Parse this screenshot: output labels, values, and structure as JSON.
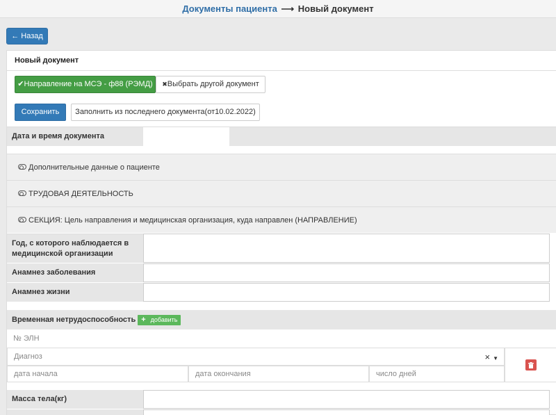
{
  "breadcrumb": {
    "parent": "Документы пациента",
    "arrow": "⟶",
    "current": "Новый документ"
  },
  "back_button": {
    "icon": "←",
    "label": "Назад"
  },
  "panel": {
    "title": "Новый документ"
  },
  "doc_type": {
    "selected_icon": "✔",
    "selected_label": "Направление на МСЭ - ф88 (РЭМД)",
    "other_icon": "✖",
    "other_label": "Выбрать другой документ"
  },
  "actions": {
    "save_label": "Сохранить",
    "fill_label": "Заполнить из последнего документа(от10.02.2022)"
  },
  "fields": {
    "date_label": "Дата и время документа",
    "year_label": "Год, с которого наблюдается в медицинской организации",
    "anamnesis_disease_label": "Анамнез заболевания",
    "anamnesis_life_label": "Анамнез жизни",
    "weight_label": "Масса тела(кг)"
  },
  "sections": [
    {
      "label": "Дополнительные данные о пациенте"
    },
    {
      "label": "ТРУДОВАЯ ДЕЯТЕЛЬНОСТЬ"
    },
    {
      "label": "СЕКЦИЯ: Цель направления и медицинская организация, куда направлен (НАПРАВЛЕНИЕ)"
    }
  ],
  "disability": {
    "title": "Временная нетрудоспособность",
    "add_icon": "+",
    "add_label": "добавить",
    "eln_placeholder": "№ ЭЛН",
    "diagnosis_placeholder": "Диагноз",
    "clear_icon": "×",
    "dropdown_icon": "▼",
    "start_placeholder": "дата начала",
    "end_placeholder": "дата окончания",
    "days_placeholder": "число дней",
    "delete_icon": "trash-icon"
  },
  "colors": {
    "primary": "#337ab7",
    "success": "#449d44",
    "danger": "#d9534f",
    "add": "#5cb85c"
  }
}
